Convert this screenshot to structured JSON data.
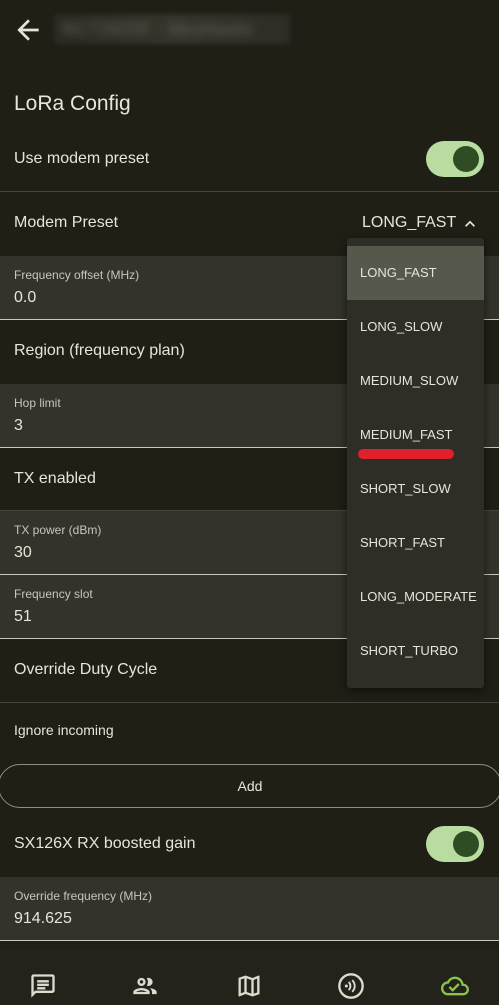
{
  "header": {
    "back_icon": "arrow-back-icon",
    "title": "!6C726D5F - Meshtastic"
  },
  "section": {
    "title": "LoRa Config"
  },
  "use_modem_preset": {
    "label": "Use modem preset",
    "enabled": true
  },
  "modem_preset": {
    "label": "Modem Preset",
    "value": "LONG_FAST",
    "chevron_icon": "chevron-up-icon",
    "options": [
      "LONG_FAST",
      "LONG_SLOW",
      "MEDIUM_SLOW",
      "MEDIUM_FAST",
      "SHORT_SLOW",
      "SHORT_FAST",
      "LONG_MODERATE",
      "SHORT_TURBO"
    ]
  },
  "frequency_offset": {
    "label": "Frequency offset (MHz)",
    "value": "0.0"
  },
  "region": {
    "label": "Region (frequency plan)"
  },
  "hop_limit": {
    "label": "Hop limit",
    "value": "3"
  },
  "tx_enabled": {
    "label": "TX enabled"
  },
  "tx_power": {
    "label": "TX power (dBm)",
    "value": "30"
  },
  "frequency_slot": {
    "label": "Frequency slot",
    "value": "51"
  },
  "override_duty_cycle": {
    "label": "Override Duty Cycle"
  },
  "ignore_incoming": {
    "label": "Ignore incoming",
    "add_label": "Add"
  },
  "rx_boosted_gain": {
    "label": "SX126X RX boosted gain",
    "enabled": true
  },
  "override_frequency": {
    "label": "Override frequency (MHz)",
    "value": "914.625"
  },
  "bottom_nav": {
    "items": [
      "messages-icon",
      "contacts-icon",
      "map-icon",
      "nodes-icon",
      "connection-cloud-icon"
    ]
  },
  "colors": {
    "background": "#1f1f16",
    "toggle_track": "#b9dca1",
    "toggle_knob": "#2f4d25",
    "accent_cloud": "#8bc34a",
    "annotation_red": "#e0202a"
  }
}
